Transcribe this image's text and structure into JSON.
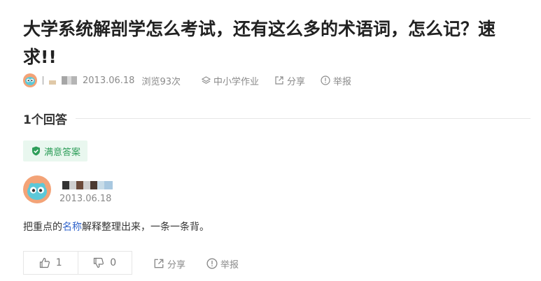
{
  "question": {
    "title": "大学系统解剖学怎么考试，还有这么多的术语词，怎么记？速求!!",
    "date": "2013.06.18",
    "views": "浏览93次",
    "category": "中小学作业",
    "share": "分享",
    "report": "举报"
  },
  "answers_section": {
    "count_label": "1个回答"
  },
  "best_answer": {
    "badge": "满意答案",
    "date": "2013.06.18",
    "text_before": "把重点的",
    "text_link": "名称",
    "text_after": "解释整理出来，一条一条背。",
    "likes": "1",
    "dislikes": "0",
    "share": "分享",
    "report": "举报"
  },
  "colors": {
    "accent_green": "#2f9e5a",
    "badge_bg": "#e9f7ef",
    "link_blue": "#3366cc",
    "avatar_bg": "#f3a377"
  },
  "icons": {
    "avatar": "owl-face-icon",
    "category": "layers-icon",
    "share": "share-arrow-icon",
    "report": "exclamation-circle-icon",
    "badge": "shield-check-icon",
    "like": "thumbs-up-icon",
    "dislike": "thumbs-down-icon"
  }
}
